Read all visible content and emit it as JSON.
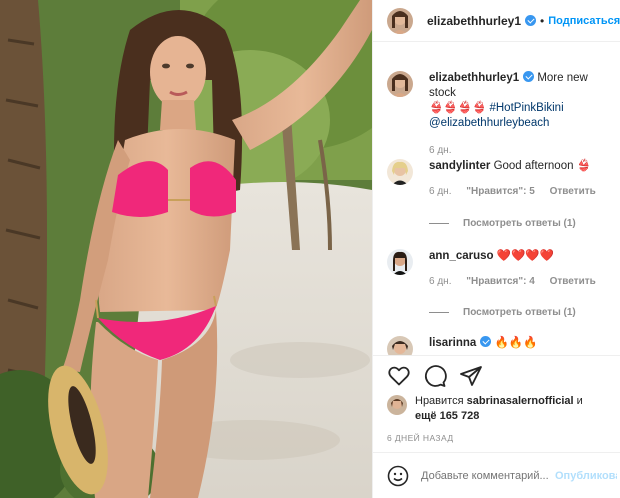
{
  "header": {
    "username": "elizabethhurley1",
    "dot": "•",
    "follow_label": "Подписаться"
  },
  "caption": {
    "username": "elizabethhurley1",
    "text": "More new stock",
    "emojis": "👙👙👙👙",
    "hashtag": "#HotPinkBikini",
    "mention": "@elizabethhurleybeach",
    "time": "6 дн."
  },
  "comments": [
    {
      "username": "sandylinter",
      "text": "Good afternoon 👙",
      "time": "6 дн.",
      "likes": "\"Нравится\": 5",
      "reply": "Ответить",
      "view_replies": "Посмотреть ответы (1)"
    },
    {
      "username": "ann_caruso",
      "text": "❤️❤️❤️❤️",
      "time": "6 дн.",
      "likes": "\"Нравится\": 4",
      "reply": "Ответить",
      "view_replies": "Посмотреть ответы (1)"
    },
    {
      "username": "lisarinna",
      "text": "🔥🔥🔥",
      "verified": true
    }
  ],
  "actions": {
    "like_icon": "heart-icon",
    "comment_icon": "comment-icon",
    "share_icon": "paper-plane-icon"
  },
  "likes": {
    "prefix": "Нравится",
    "user": "sabrinasalernofficial",
    "suffix": "и",
    "more": "ещё 165 728"
  },
  "posted": "6 ДНЕЙ НАЗАД",
  "add_comment": {
    "placeholder": "Добавьте комментарий...",
    "publish_label": "Опубликовать"
  },
  "colors": {
    "accent": "#0095f6",
    "verified": "#3897f0",
    "bikini": "#f0287a"
  }
}
